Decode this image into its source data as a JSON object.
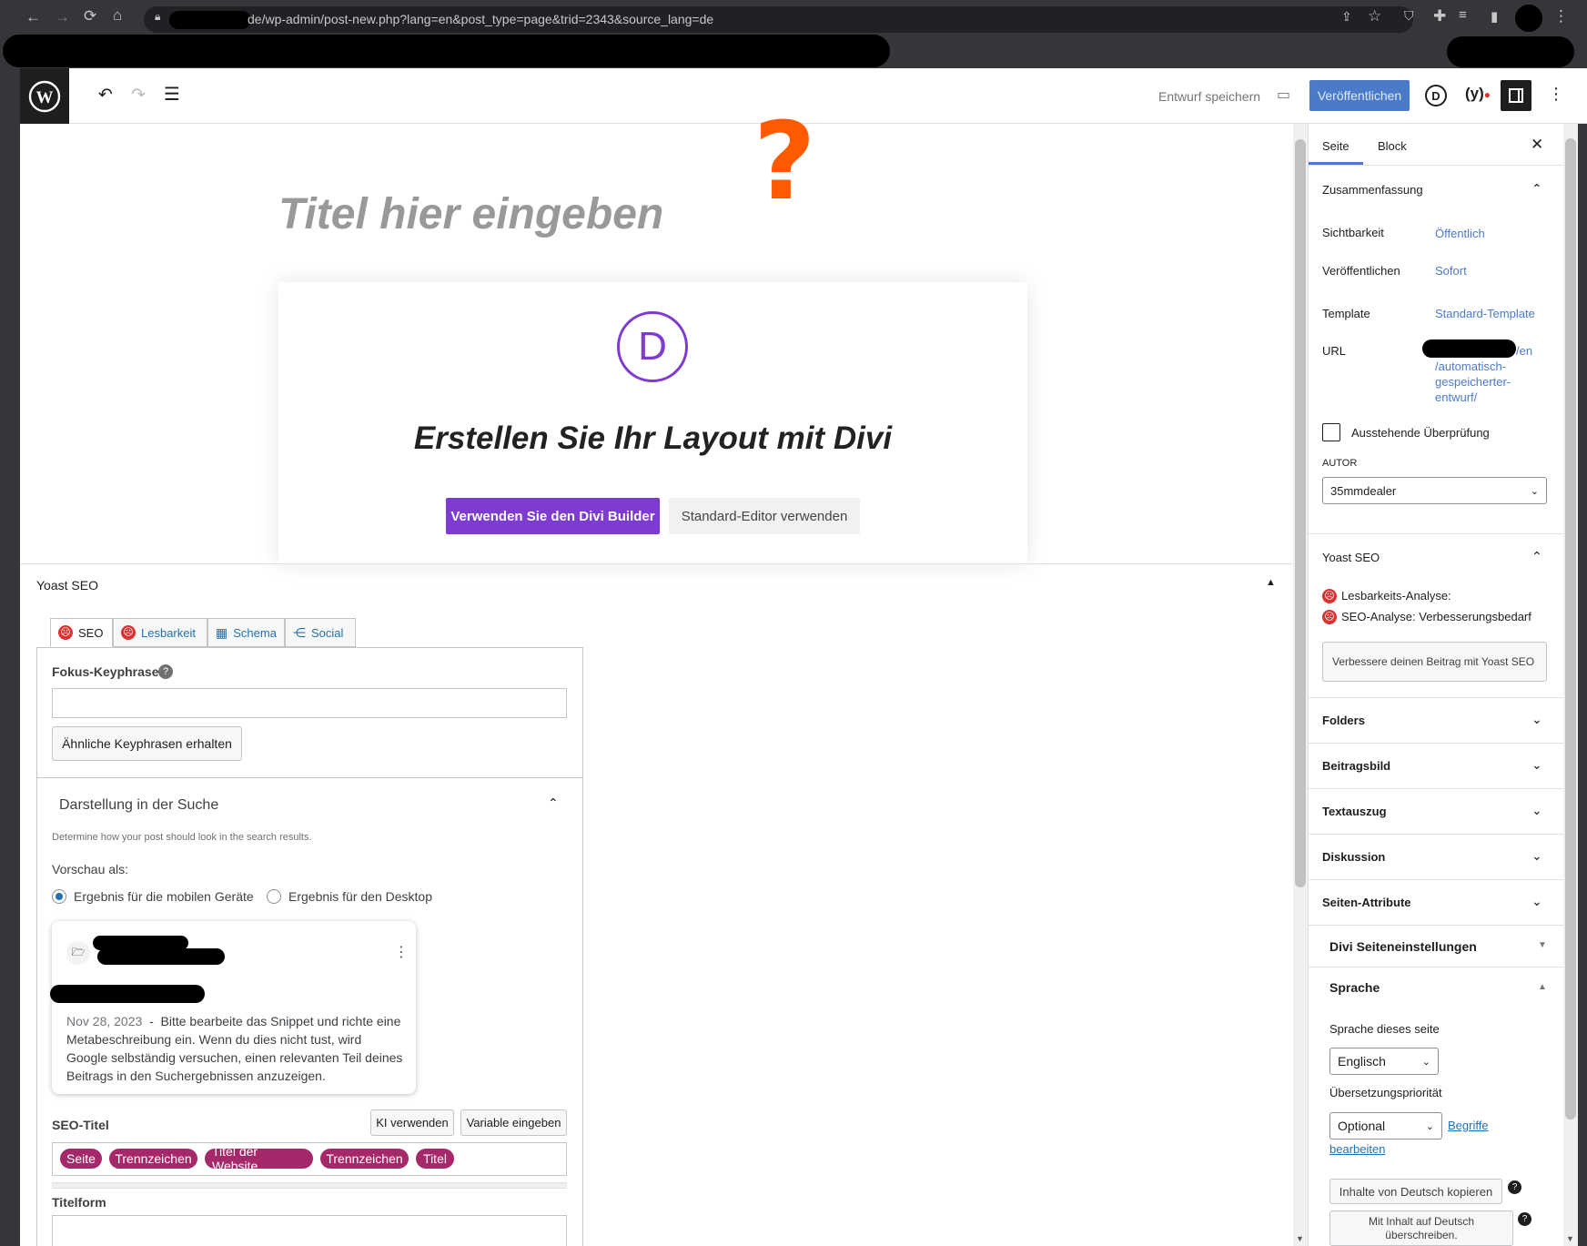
{
  "browser": {
    "url": "de/wp-admin/post-new.php?lang=en&post_type=page&trid=2343&source_lang=de"
  },
  "topbar": {
    "save_draft": "Entwurf speichern",
    "publish": "Veröffentlichen",
    "divi_icon": "D"
  },
  "editor": {
    "title_placeholder": "Titel hier eingeben",
    "question_mark": "?",
    "divi": {
      "logo": "D",
      "heading": "Erstellen Sie Ihr Layout mit Divi",
      "use_builder": "Verwenden Sie den Divi Builder",
      "use_default": "Standard-Editor verwenden"
    }
  },
  "yoast": {
    "panel_title": "Yoast SEO",
    "tabs": [
      "SEO",
      "Lesbarkeit",
      "Schema",
      "Social"
    ],
    "focus_label": "Fokus-Keyphrase",
    "related_btn": "Ähnliche Keyphrasen erhalten",
    "search_section": "Darstellung in der Suche",
    "search_help": "Determine how your post should look in the search results.",
    "preview_as": "Vorschau als:",
    "radio_mobile": "Ergebnis für die mobilen Geräte",
    "radio_desktop": "Ergebnis für den Desktop",
    "snippet_date": "Nov 28, 2023",
    "snippet_sep": "-",
    "snippet_text": "Bitte bearbeite das Snippet und richte eine Metabeschreibung ein. Wenn du dies nicht tust, wird Google selbständig versuchen, einen relevanten Teil deines Beitrags in den Suchergebnissen anzuzeigen.",
    "seo_title_label": "SEO-Titel",
    "ai_btn": "KI verwenden",
    "var_btn": "Variable eingeben",
    "pills": [
      "Seite",
      "Trennzeichen",
      "Titel der Website",
      "Trennzeichen",
      "Titel"
    ],
    "titleform_label": "Titelform"
  },
  "sidebar": {
    "tab_page": "Seite",
    "tab_block": "Block",
    "summary": "Zusammenfassung",
    "visibility_label": "Sichtbarkeit",
    "visibility_value": "Öffentlich",
    "publish_label": "Veröffentlichen",
    "publish_value": "Sofort",
    "template_label": "Template",
    "template_value": "Standard-Template",
    "url_label": "URL",
    "url_l1": "/en",
    "url_l2": "/automatisch-",
    "url_l3": "gespeicherter-",
    "url_l4": "entwurf/",
    "pending_review": "Ausstehende Überprüfung",
    "author_label": "AUTOR",
    "author_value": "35mmdealer",
    "yoast_title": "Yoast SEO",
    "readability_label": "Lesbarkeits-Analyse:",
    "seo_analysis_label": "SEO-Analyse:",
    "seo_analysis_value": "Verbesserungsbedarf",
    "improve_btn": "Verbessere deinen Beitrag mit Yoast SEO",
    "folders": "Folders",
    "featured_image": "Beitragsbild",
    "excerpt": "Textauszug",
    "discussion": "Diskussion",
    "page_attributes": "Seiten-Attribute",
    "divi_settings": "Divi Seiteneinstellungen",
    "language": "Sprache",
    "page_language_label": "Sprache dieses seite",
    "page_language_value": "Englisch",
    "priority_label": "Übersetzungspriorität",
    "priority_value": "Optional",
    "edit_terms_1": "Begriffe",
    "edit_terms_2": "bearbeiten",
    "copy_btn": "Inhalte von Deutsch kopieren",
    "overwrite_btn_1": "Mit Inhalt auf Deutsch",
    "overwrite_btn_2": "überschreiben."
  }
}
